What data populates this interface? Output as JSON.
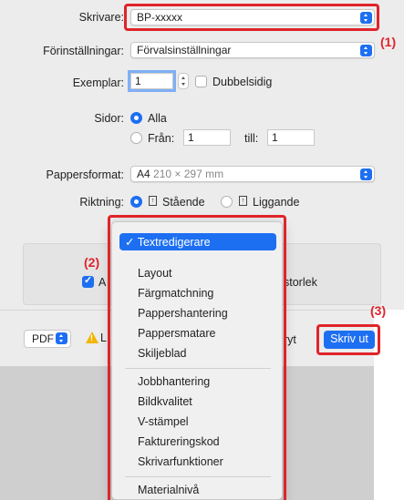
{
  "printer": {
    "label": "Skrivare:",
    "value": "BP-xxxxx"
  },
  "presets": {
    "label": "Förinställningar:",
    "value": "Förvalsinställningar"
  },
  "copies": {
    "label": "Exemplar:",
    "value": "1",
    "duplex_label": "Dubbelsidig"
  },
  "pages": {
    "label": "Sidor:",
    "all_label": "Alla",
    "from_label": "Från:",
    "from_value": "1",
    "to_label": "till:",
    "to_value": "1"
  },
  "paper": {
    "label": "Pappersformat:",
    "value": "A4",
    "size": "210 × 297 mm"
  },
  "orientation": {
    "label": "Riktning:",
    "portrait": "Stående",
    "landscape": "Liggande"
  },
  "panel": {
    "checkbox_prefix": "A",
    "suffix_text": "storlek"
  },
  "footer": {
    "pdf_label": "PDF",
    "warning_text": "L",
    "hidden_text": "ryt",
    "print_label": "Skriv ut"
  },
  "callouts": {
    "c1": "(1)",
    "c2": "(2)",
    "c3": "(3)"
  },
  "menu": {
    "selected": "✓ Textredigerare",
    "group1": [
      "Layout",
      "Färgmatchning",
      "Pappershantering",
      "Pappersmatare",
      "Skiljeblad"
    ],
    "group2": [
      "Jobbhantering",
      "Bildkvalitet",
      "V-stämpel",
      "Faktureringskod",
      "Skrivarfunktioner"
    ],
    "group3": [
      "Materialnivå"
    ]
  },
  "colors": {
    "accent": "#1d6ff2",
    "highlight": "#e0242a",
    "warning": "#f2b600"
  }
}
